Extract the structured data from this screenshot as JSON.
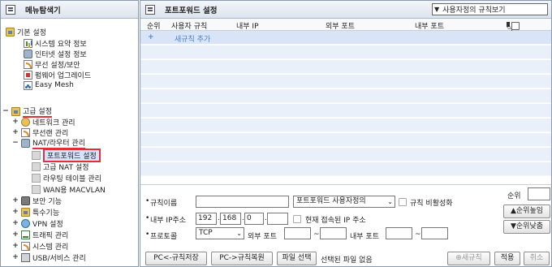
{
  "left_panel": {
    "title": "메뉴탐색기",
    "basic": {
      "label": "기본 설정",
      "items": [
        "시스템 요약 정보",
        "인터넷 설정 정보",
        "무선 설정/보안",
        "펌웨어 업그레이드",
        "Easy Mesh"
      ]
    },
    "advanced": {
      "label": "고급 설정",
      "items": {
        "network": "네트워크 관리",
        "wireless": "무선랜 관리",
        "nat": "NAT/라우터 관리",
        "nat_children": [
          "포트포워드 설정",
          "고급 NAT 설정",
          "라우팅 테이블 관리",
          "WAN용 MACVLAN"
        ],
        "security": "보안 기능",
        "special": "특수기능",
        "vpn": "VPN 설정",
        "traffic": "트래픽 관리",
        "system": "시스템 관리",
        "usb": "USB/서비스 관리"
      }
    }
  },
  "right_panel": {
    "title": "포트포워드 설정",
    "view_select": "사용자정의 규칙보기",
    "columns": {
      "order": "순위",
      "rule": "사용자 규칙",
      "internal_ip": "내부 IP",
      "external_port": "외부 포트",
      "internal_port": "내부 포트",
      "delete": "삭제"
    },
    "add_rule": {
      "plus": "+",
      "label": "새규칙 추가"
    },
    "form": {
      "rule_name_label": "규칙이름",
      "rule_type_select": "포트포워드 사용자정의",
      "disable_label": "규칙 비활성화",
      "internal_ip_label": "내부 IP주소",
      "ip": [
        "192",
        "168",
        "0",
        ""
      ],
      "current_ip_label": "현재 접속된 IP 주소",
      "protocol_label": "프로토콜",
      "protocol_value": "TCP",
      "external_port_label": "외부 포트",
      "internal_port_label": "내부 포트",
      "tilde": "~",
      "bullet": "•",
      "rank_label": "순위",
      "rank_up": "▲순위높임",
      "rank_down": "▼순위낮춤"
    },
    "buttons": {
      "save_pc": "PC<-규칙저장",
      "restore_pc": "PC->규칙복원",
      "file_select": "파일 선택",
      "no_file": "선택된 파일 없음",
      "new_rule": "⊕새규칙",
      "apply": "적용",
      "cancel": "취소"
    }
  },
  "colors": {
    "accent_red": "#e0303a",
    "row_blue": "#eaf0fa",
    "link_blue": "#4b82c4"
  }
}
